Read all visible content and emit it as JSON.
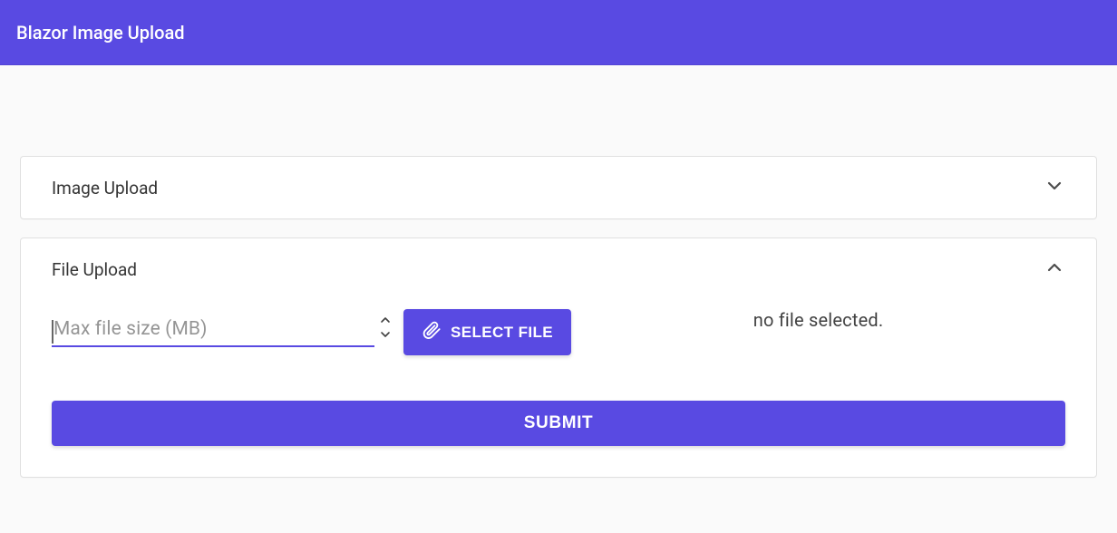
{
  "appbar": {
    "title": "Blazor Image Upload"
  },
  "panels": {
    "image_upload": {
      "title": "Image Upload",
      "expanded": false
    },
    "file_upload": {
      "title": "File Upload",
      "expanded": true
    }
  },
  "file_size_field": {
    "placeholder": "Max file size (MB)",
    "value": ""
  },
  "select_file_button": {
    "label": "SELECT FILE"
  },
  "file_status": "no file selected.",
  "submit_button": {
    "label": "SUBMIT"
  },
  "colors": {
    "accent": "#594ae2"
  }
}
